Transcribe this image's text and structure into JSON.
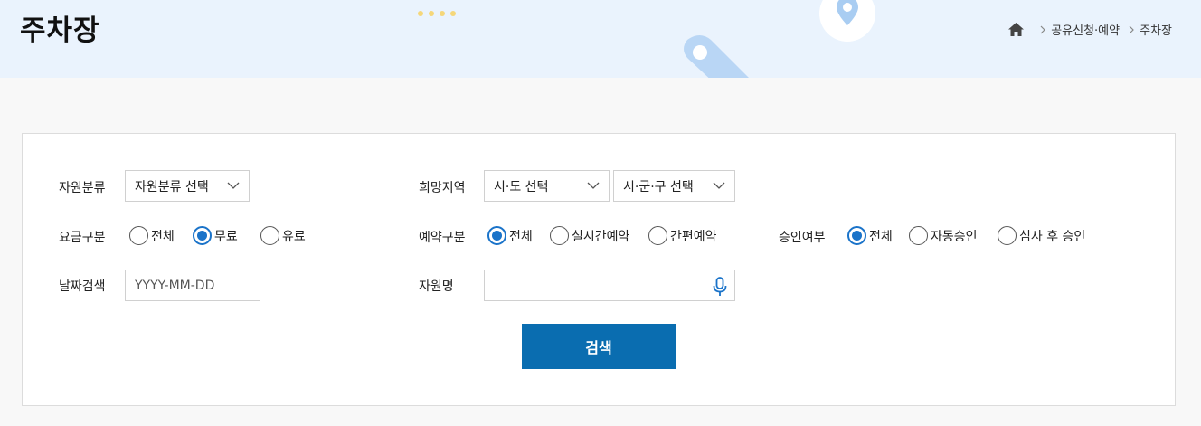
{
  "header": {
    "title": "주차장",
    "breadcrumb": [
      "공유신청·예약",
      "주차장"
    ]
  },
  "form": {
    "resource_category": {
      "label": "자원분류",
      "value": "자원분류 선택"
    },
    "region": {
      "label": "희망지역",
      "sido": "시·도 선택",
      "sigungu": "시·군·구 선택"
    },
    "fee": {
      "label": "요금구분",
      "options": [
        "전체",
        "무료",
        "유료"
      ],
      "selected": "무료"
    },
    "reservation_type": {
      "label": "예약구분",
      "options": [
        "전체",
        "실시간예약",
        "간편예약"
      ],
      "selected": "전체"
    },
    "approval": {
      "label": "승인여부",
      "options": [
        "전체",
        "자동승인",
        "심사 후 승인"
      ],
      "selected": "전체"
    },
    "date": {
      "label": "날짜검색",
      "placeholder": "YYYY-MM-DD"
    },
    "resource_name": {
      "label": "자원명",
      "value": ""
    },
    "search_button": "검색"
  },
  "colors": {
    "accent": "#1a73c9",
    "button": "#0a6db0",
    "header_bg": "#eaf3fd"
  }
}
